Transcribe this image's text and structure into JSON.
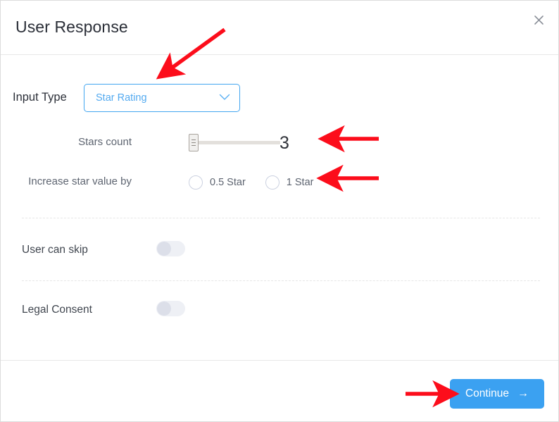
{
  "header": {
    "title": "User Response",
    "close_icon": "close-icon"
  },
  "form": {
    "input_type": {
      "label": "Input Type",
      "selected_value": "Star Rating",
      "chevron_icon": "chevron-down-icon"
    },
    "stars_count": {
      "label": "Stars count",
      "value": "3",
      "slider_icon": "slider-handle-grip-icon"
    },
    "increase_star_value": {
      "label": "Increase star value by",
      "options": [
        {
          "label": "0.5 Star",
          "selected": false
        },
        {
          "label": "1 Star",
          "selected": false
        }
      ]
    },
    "user_can_skip": {
      "label": "User can skip",
      "state": "off"
    },
    "legal_consent": {
      "label": "Legal Consent",
      "state": "off"
    }
  },
  "footer": {
    "continue_label": "Continue",
    "continue_arrow_icon": "arrow-right-icon"
  },
  "colors": {
    "accent_blue": "#3ba1f1",
    "select_border_blue": "#43a6f0",
    "select_text_blue": "#53aaf0",
    "annotation_red": "#fc0d1b",
    "toggle_track": "#eef0f5",
    "toggle_knob": "#dcdfe9",
    "slider_track": "#e3e0dc",
    "text_dark": "#2b2f38",
    "text_muted": "#5d6470"
  },
  "annotations": {
    "arrow_to_input_type": "arrow-annotation-input-type",
    "arrow_to_stars_count": "arrow-annotation-stars-count",
    "arrow_to_increase_star_value": "arrow-annotation-increase-star-value",
    "arrow_to_continue": "arrow-annotation-continue"
  }
}
